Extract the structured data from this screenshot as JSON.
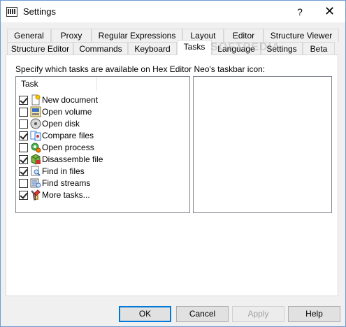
{
  "window": {
    "title": "Settings",
    "help_glyph": "?",
    "close_glyph": "✕"
  },
  "tabs_row1": [
    "General",
    "Proxy",
    "Regular Expressions",
    "Layout",
    "Editor",
    "Structure Viewer"
  ],
  "tabs_row2": [
    "Structure Editor",
    "Commands",
    "Keyboard",
    "Tasks",
    "Language",
    "Settings",
    "Beta"
  ],
  "selected_tab": "Tasks",
  "panel": {
    "description": "Specify which tasks are available on Hex Editor Neo's taskbar icon:",
    "list_header": "Task",
    "tasks": [
      {
        "label": "New document",
        "checked": true,
        "icon": "new-document-icon"
      },
      {
        "label": "Open volume",
        "checked": false,
        "icon": "open-volume-icon"
      },
      {
        "label": "Open disk",
        "checked": false,
        "icon": "open-disk-icon"
      },
      {
        "label": "Compare files",
        "checked": true,
        "icon": "compare-files-icon"
      },
      {
        "label": "Open process",
        "checked": false,
        "icon": "open-process-icon"
      },
      {
        "label": "Disassemble file",
        "checked": true,
        "icon": "disassemble-file-icon"
      },
      {
        "label": "Find in files",
        "checked": true,
        "icon": "find-in-files-icon"
      },
      {
        "label": "Find streams",
        "checked": false,
        "icon": "find-streams-icon"
      },
      {
        "label": "More tasks...",
        "checked": true,
        "icon": "more-tasks-icon"
      }
    ]
  },
  "buttons": {
    "ok": "OK",
    "cancel": "Cancel",
    "apply": "Apply",
    "help": "Help"
  },
  "watermark": "SOFTPEDIA"
}
